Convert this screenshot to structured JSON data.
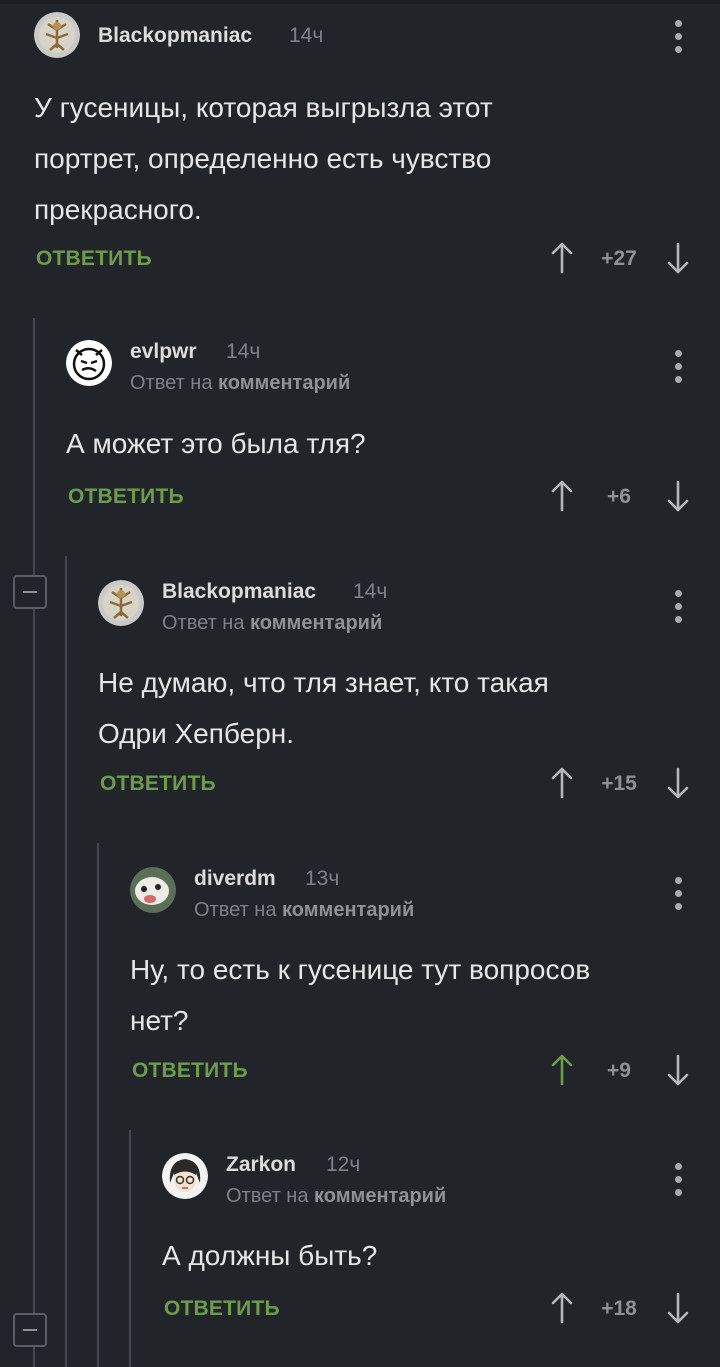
{
  "comments": [
    {
      "author": "Blackopmaniac",
      "time": "14ч",
      "text_lines": [
        "У гусеницы, которая выгрызла этот",
        "портрет, определенно есть чувство",
        "прекрасного."
      ],
      "reply_label": "ОТВЕТИТЬ",
      "score": "+27",
      "upvoted": false
    },
    {
      "author": "evlpwr",
      "time": "14ч",
      "reply_prefix": "Ответ на",
      "reply_target": "комментарий",
      "text_lines": [
        "А может это была тля?"
      ],
      "reply_label": "ОТВЕТИТЬ",
      "score": "+6",
      "upvoted": false
    },
    {
      "author": "Blackopmaniac",
      "time": "14ч",
      "reply_prefix": "Ответ на",
      "reply_target": "комментарий",
      "text_lines": [
        "Не думаю, что тля знает, кто такая",
        "Одри Хепберн."
      ],
      "reply_label": "ОТВЕТИТЬ",
      "score": "+15",
      "upvoted": false
    },
    {
      "author": "diverdm",
      "time": "13ч",
      "reply_prefix": "Ответ на",
      "reply_target": "комментарий",
      "text_lines": [
        "Ну, то есть к гусенице тут вопросов",
        "нет?"
      ],
      "reply_label": "ОТВЕТИТЬ",
      "score": "+9",
      "upvoted": true
    },
    {
      "author": "Zarkon",
      "time": "12ч",
      "reply_prefix": "Ответ на",
      "reply_target": "комментарий",
      "text_lines": [
        "А должны быть?"
      ],
      "reply_label": "ОТВЕТИТЬ",
      "score": "+18",
      "upvoted": false
    }
  ],
  "colors": {
    "background": "#212429",
    "reply_green": "#6d9c4b",
    "upvote_active": "#6d9c4b",
    "muted": "#7e8187"
  },
  "icons": {
    "more": "more-vertical-icon",
    "upvote": "arrow-up-icon",
    "downvote": "arrow-down-icon",
    "collapse": "collapse-minus-icon"
  }
}
